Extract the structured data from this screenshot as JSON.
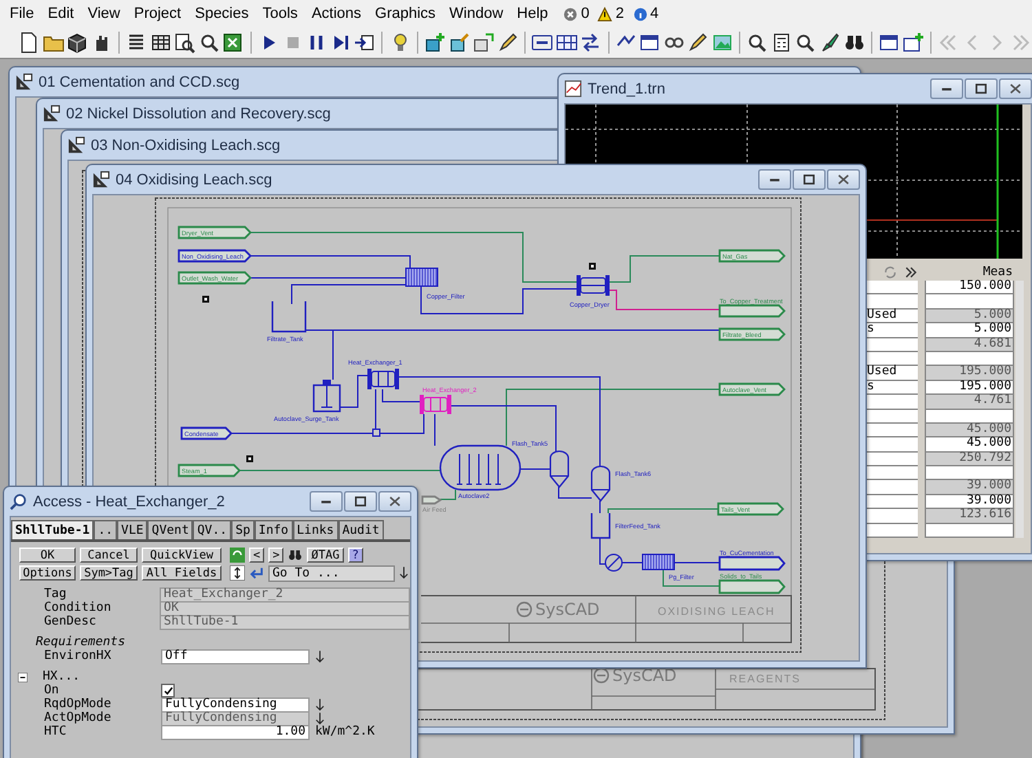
{
  "menu": [
    "File",
    "Edit",
    "View",
    "Project",
    "Species",
    "Tools",
    "Actions",
    "Graphics",
    "Window",
    "Help"
  ],
  "status_counts": [
    {
      "kind": "error",
      "count": "0"
    },
    {
      "kind": "warning",
      "count": "2"
    },
    {
      "kind": "info",
      "count": "4"
    }
  ],
  "flowsheet_windows": [
    {
      "title": "01 Cementation and CCD.scg"
    },
    {
      "title": "02 Nickel Dissolution and Recovery.scg"
    },
    {
      "title": "03 Non-Oxidising Leach.scg",
      "title_block": {
        "logo": "SysCAD",
        "name": "REAGENTS"
      }
    },
    {
      "title": "04 Oxidising Leach.scg",
      "title_block": {
        "logo": "SysCAD",
        "name": "OXIDISING LEACH"
      },
      "flowsheet": {
        "tags": [
          {
            "text": "Dryer_Vent",
            "color": "#2a8a4a"
          },
          {
            "text": "Non_Oxidising_Leach",
            "color": "#2020c0"
          },
          {
            "text": "Outlet_Wash_Water",
            "color": "#2a8a4a"
          },
          {
            "text": "Nat_Gas",
            "color": "#2a8a4a"
          },
          {
            "text": "To_Copper_Treatment",
            "color": "#2a8a4a"
          },
          {
            "text": "Filtrate_Bleed",
            "color": "#2a8a4a"
          },
          {
            "text": "Autoclave_Vent",
            "color": "#2a8a4a"
          },
          {
            "text": "Condensate",
            "color": "#2020c0"
          },
          {
            "text": "Steam_1",
            "color": "#2a8a4a"
          },
          {
            "text": "Air Feed",
            "color": "#808080"
          },
          {
            "text": "Tails_Vent",
            "color": "#2a8a4a"
          },
          {
            "text": "To_CuCementation",
            "color": "#2020c0"
          },
          {
            "text": "Solids_to_Tails",
            "color": "#2a8a4a"
          }
        ],
        "units": [
          {
            "label": "Copper_Filter",
            "kind": "filter",
            "selected": false
          },
          {
            "label": "Filtrate_Tank",
            "kind": "open-tank",
            "selected": false
          },
          {
            "label": "Copper_Dryer",
            "kind": "dryer",
            "selected": false
          },
          {
            "label": "Heat_Exchanger_1",
            "kind": "exchanger",
            "selected": false
          },
          {
            "label": "Heat_Exchanger_2",
            "kind": "exchanger",
            "selected": true
          },
          {
            "label": "Autoclave_Surge_Tank",
            "kind": "agitated-tank",
            "selected": false
          },
          {
            "label": "Autoclave2",
            "kind": "autoclave",
            "selected": false
          },
          {
            "label": "Flash_Tank5",
            "kind": "flash-tank",
            "selected": false
          },
          {
            "label": "Flash_Tank6",
            "kind": "flash-tank",
            "selected": false
          },
          {
            "label": "FilterFeed_Tank",
            "kind": "open-tank",
            "selected": false
          },
          {
            "label": "Pg_Filter",
            "kind": "filter",
            "selected": false
          }
        ]
      }
    }
  ],
  "trend_window": {
    "title": "Trend_1.trn",
    "table": {
      "header": "Meas",
      "rows": [
        {
          "value": "150.000",
          "computed": false
        },
        {
          "computed": false
        },
        {
          "label": "Used",
          "value": "5.000",
          "computed": true
        },
        {
          "label": "s",
          "value": "5.000",
          "computed": false
        },
        {
          "value": "4.681",
          "computed": true
        },
        {
          "computed": false
        },
        {
          "label": "Used",
          "value": "195.000",
          "computed": true
        },
        {
          "label": "s",
          "value": "195.000",
          "computed": false
        },
        {
          "value": "4.761",
          "computed": true
        },
        {
          "computed": false
        },
        {
          "value": "45.000",
          "computed": true
        },
        {
          "value": "45.000",
          "computed": false
        },
        {
          "value": "250.792",
          "computed": true
        },
        {
          "computed": false
        },
        {
          "value": "39.000",
          "computed": true
        },
        {
          "value": "39.000",
          "computed": false
        },
        {
          "value": "123.616",
          "computed": true
        },
        {
          "computed": false
        }
      ]
    }
  },
  "access_window": {
    "title": "Access - Heat_Exchanger_2",
    "tabs": [
      {
        "label": "ShllTube-1",
        "selected": true
      },
      {
        "label": "..",
        "selected": false
      },
      {
        "label": "VLE",
        "selected": false
      },
      {
        "label": "QVent",
        "selected": false
      },
      {
        "label": "QV..",
        "selected": false
      },
      {
        "label": "Sp",
        "selected": false
      },
      {
        "label": "Info",
        "selected": false
      },
      {
        "label": "Links",
        "selected": false
      },
      {
        "label": "Audit",
        "selected": false
      }
    ],
    "buttons": [
      "OK",
      "Cancel",
      "QuickView",
      "Options",
      "Sym>Tag",
      "All Fields"
    ],
    "nav_buttons": [
      "<",
      ">",
      "ØTAG",
      "?"
    ],
    "goto": "Go To ...",
    "fields": [
      {
        "kind": "readonly",
        "label": "Tag",
        "value": "Heat_Exchanger_2"
      },
      {
        "kind": "readonly",
        "label": "Condition",
        "value": "OK"
      },
      {
        "kind": "readonly",
        "label": "GenDesc",
        "value": "ShllTube-1"
      },
      {
        "kind": "heading",
        "label": "Requirements"
      },
      {
        "kind": "dropdown",
        "label": "EnvironHX",
        "value": "Off",
        "disabled": false
      },
      {
        "kind": "group",
        "label": "HX...",
        "expanded": true
      },
      {
        "kind": "check",
        "label": "On",
        "checked": true
      },
      {
        "kind": "dropdown",
        "label": "RqdOpMode",
        "value": "FullyCondensing",
        "disabled": false
      },
      {
        "kind": "dropdown",
        "label": "ActOpMode",
        "value": "FullyCondensing",
        "disabled": true
      },
      {
        "kind": "number",
        "label": "HTC",
        "value": "1.00",
        "unit": "kW/m^2.K"
      }
    ]
  }
}
